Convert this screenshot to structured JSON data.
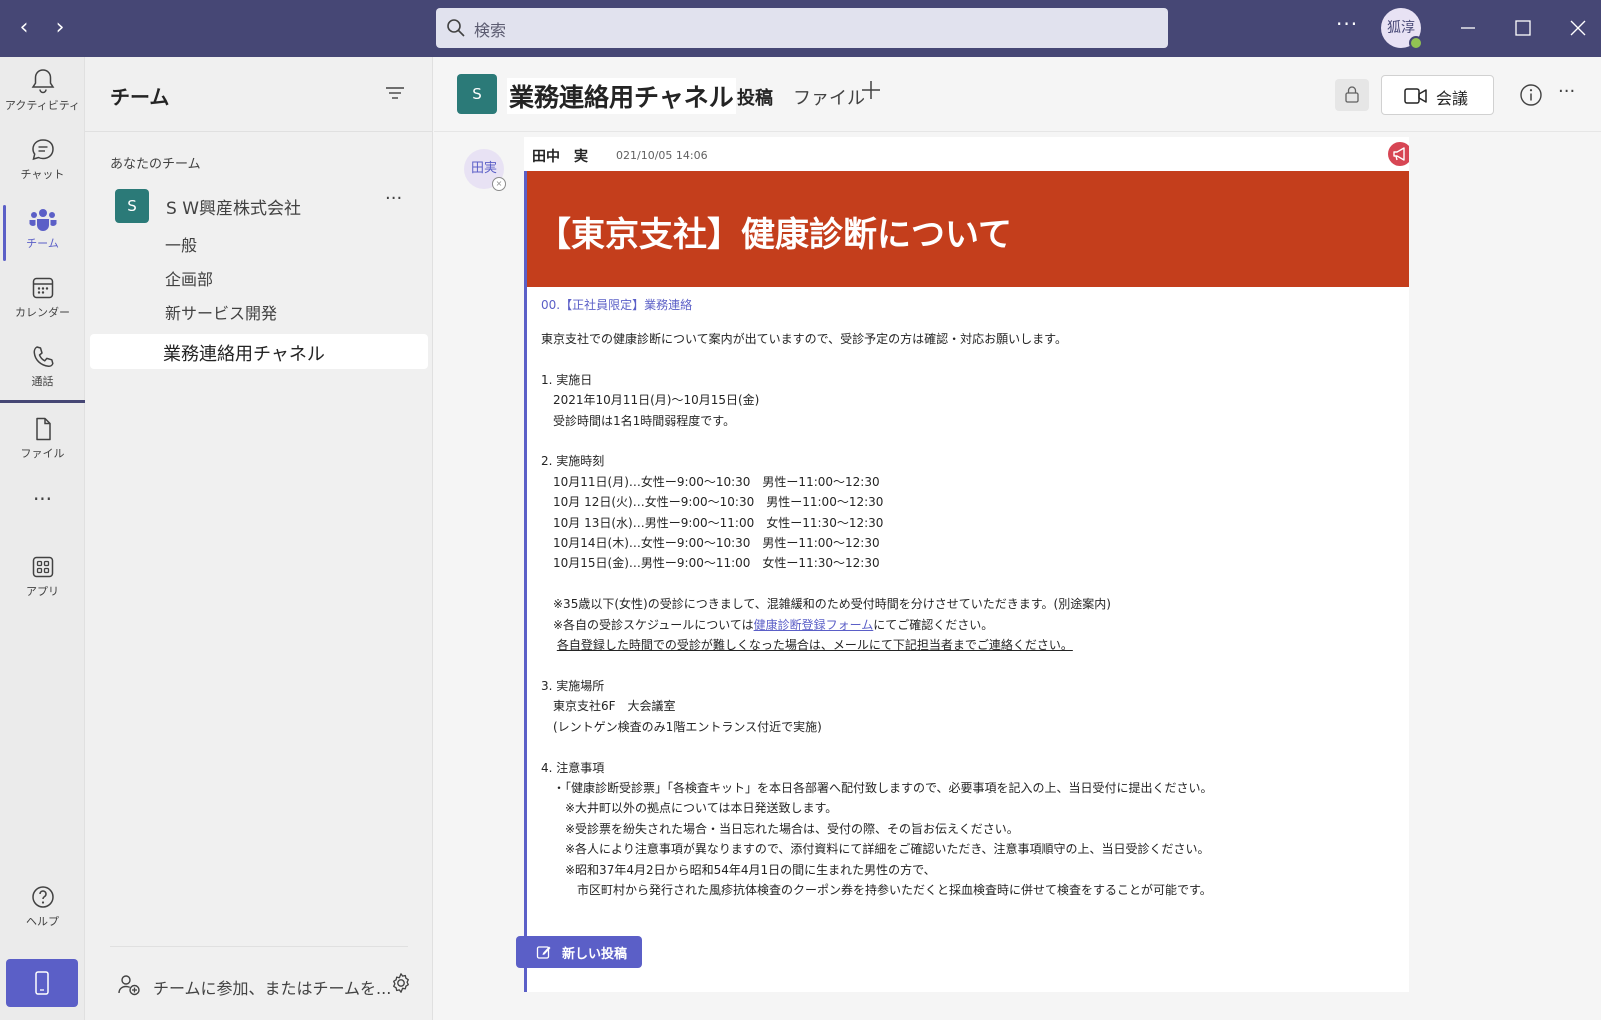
{
  "titlebar": {
    "search_placeholder": "検索",
    "more": "···",
    "user_initials": "狐淳"
  },
  "rail": {
    "items": [
      {
        "label": "アクティビティ"
      },
      {
        "label": "チャット"
      },
      {
        "label": "チーム"
      },
      {
        "label": "カレンダー"
      },
      {
        "label": "通話"
      },
      {
        "label": "ファイル"
      },
      {
        "label": "アプリ"
      },
      {
        "label": "ヘルプ"
      }
    ],
    "more": "···"
  },
  "teams_pane": {
    "title": "チーム",
    "section_label": "あなたのチーム",
    "team": {
      "badge": "S",
      "name": "S W興産株式会社",
      "more": "···"
    },
    "channels": [
      "一般",
      "企画部",
      "新サービス開発"
    ],
    "active_channel": "業務連絡用チャネル",
    "join_label": "チームに参加、またはチームを..."
  },
  "channel": {
    "badge": "S",
    "name": "業務連絡用チャネル",
    "tabs": [
      "投稿",
      "ファイル"
    ],
    "meet_label": "会議",
    "more": "···"
  },
  "post": {
    "avatar_initials": "田実",
    "author": "田中　実",
    "timestamp": "021/10/05 14:06",
    "banner_title": "【東京支社】健康診断について",
    "subject": "00.【正社員限定】業務連絡",
    "body": {
      "intro": "東京支社での健康診断について案内が出ていますので、受診予定の方は確認・対応お願いします。",
      "s1_title": "1. 実施日",
      "s1_l1": "　2021年10月11日(月)〜10月15日(金)",
      "s1_l2": "　受診時間は1名1時間弱程度です。",
      "s2_title": "2. 実施時刻",
      "s2_l1": "　10月11日(月)…女性ー9:00〜10:30　男性ー11:00〜12:30",
      "s2_l2": "　10月 12日(火)…女性ー9:00〜10:30　男性ー11:00〜12:30",
      "s2_l3": "　10月 13日(水)…男性ー9:00〜11:00　女性ー11:30〜12:30",
      "s2_l4": "　10月14日(木)…女性ー9:00〜10:30　男性ー11:00〜12:30",
      "s2_l5": "　10月15日(金)…男性ー9:00〜11:00　女性ー11:30〜12:30",
      "note1": "　※35歳以下(女性)の受診につきまして、混雑緩和のため受付時間を分けさせていただきます。(別途案内)",
      "note2_pre": "　※各自の受診スケジュールについては",
      "note2_link": "健康診断登録フォーム",
      "note2_post": "にてご確認ください。",
      "note3": "各自登録した時間での受診が難しくなった場合は、メールにて下記担当者までご連絡ください。",
      "s3_title": "3. 実施場所",
      "s3_l1": "　東京支社6F　大会議室",
      "s3_l2": "　(レントゲン検査のみ1階エントランス付近で実施)",
      "s4_title": "4. 注意事項",
      "s4_l1": "　・「健康診断受診票」「各検査キット」を本日各部署へ配付致しますので、必要事項を記入の上、当日受付に提出ください。",
      "s4_l2": "　　※大井町以外の拠点については本日発送致します。",
      "s4_l3": "　　※受診票を紛失された場合・当日忘れた場合は、受付の際、その旨お伝えください。",
      "s4_l4": "　　※各人により注意事項が異なりますので、添付資料にて詳細をご確認いただき、注意事項順守の上、当日受診ください。",
      "s4_l5": "　　※昭和37年4月2日から昭和54年4月1日の間に生まれた男性の方で、",
      "s4_l6": "　　　市区町村から発行された風疹抗体検査のクーポン券を持参いただくと採血検査時に併せて検査をすることが可能です。"
    }
  },
  "new_post_label": "新しい投稿",
  "colors": {
    "titlebar": "#464775",
    "accent": "#5b5fc7",
    "banner": "#c43e1c",
    "team_badge": "#2b7a78"
  }
}
